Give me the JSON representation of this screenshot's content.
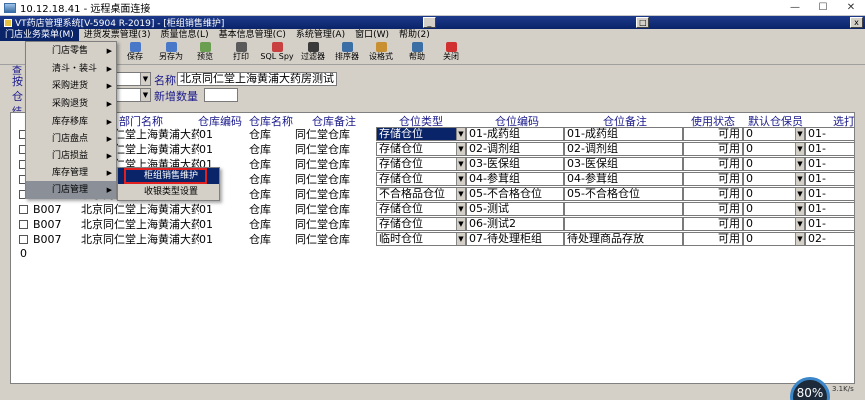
{
  "rdp": {
    "title": "10.12.18.41 - 远程桌面连接",
    "min": "—",
    "max": "☐",
    "close": "✕"
  },
  "app": {
    "title": "VT药店管理系统[V-5904 R-2019] - [柜组销售维护]",
    "btn_min": "_",
    "btn_max": "□",
    "btn_close": "x"
  },
  "menubar": [
    "门店业务菜单(M)",
    "进货发票管理(3)",
    "质量信息(L)",
    "基本信息管理(C)",
    "系统管理(A)",
    "窗口(W)",
    "帮助(2)"
  ],
  "toolbar": [
    {
      "label": "保存",
      "icon": "save-icon",
      "color": "#4a78c8"
    },
    {
      "label": "保存",
      "icon": "save-icon",
      "color": "#4a78c8"
    },
    {
      "label": "另存为",
      "icon": "save-as-icon",
      "color": "#4a78c8"
    },
    {
      "label": "预览",
      "icon": "preview-icon",
      "color": "#6a9e50"
    },
    {
      "label": "打印",
      "icon": "print-icon",
      "color": "#5a5a5a"
    },
    {
      "label": "SQL Spy",
      "icon": "sql-spy-icon",
      "color": "#c84040"
    },
    {
      "label": "过滤器",
      "icon": "filter-icon",
      "color": "#3a3a3a"
    },
    {
      "label": "排序器",
      "icon": "sort-icon",
      "color": "#3a6ea5"
    },
    {
      "label": "设格式",
      "icon": "format-icon",
      "color": "#c89030"
    },
    {
      "label": "帮助",
      "icon": "help-icon",
      "color": "#3a6ea5"
    },
    {
      "label": "关闭",
      "icon": "close-icon",
      "color": "#d03030"
    }
  ],
  "filters": {
    "left_labels": [
      "查",
      "按",
      "仓",
      "结"
    ],
    "name_label": "名称",
    "name_value": "北京同仁堂上海黄浦大药房测试",
    "add_qty_label": "新增数量",
    "add_qty_value": ""
  },
  "grid": {
    "headers": [
      "部门名称",
      "仓库编码",
      "仓库名称",
      "仓库备注",
      "仓位类型",
      "仓位编码",
      "仓位备注",
      "使用状态",
      "默认仓保员",
      "选打"
    ],
    "rows": [
      {
        "code": "",
        "dept": "北京同仁堂上海黄浦大药房",
        "wh_code": "01",
        "wh_name": "仓库",
        "wh_note": "同仁堂仓库",
        "type": "存储仓位",
        "loc_code": "01-成药组",
        "loc_note": "01-成药组",
        "status": "可用",
        "keeper": "0",
        "extra": "01-"
      },
      {
        "code": "",
        "dept": "北京同仁堂上海黄浦大药房",
        "wh_code": "01",
        "wh_name": "仓库",
        "wh_note": "同仁堂仓库",
        "type": "存储仓位",
        "loc_code": "02-调剂组",
        "loc_note": "02-调剂组",
        "status": "可用",
        "keeper": "0",
        "extra": "01-"
      },
      {
        "code": "",
        "dept": "北京同仁堂上海黄浦大药房",
        "wh_code": "01",
        "wh_name": "仓库",
        "wh_note": "同仁堂仓库",
        "type": "存储仓位",
        "loc_code": "03-医保组",
        "loc_note": "03-医保组",
        "status": "可用",
        "keeper": "0",
        "extra": "01-"
      },
      {
        "code": "",
        "dept": "北京同仁堂上海黄浦大药房",
        "wh_code": "01",
        "wh_name": "仓库",
        "wh_note": "同仁堂仓库",
        "type": "存储仓位",
        "loc_code": "04-参茸组",
        "loc_note": "04-参茸组",
        "status": "可用",
        "keeper": "0",
        "extra": "01-"
      },
      {
        "code": "B007",
        "dept": "北京同仁堂上海黄浦大药房",
        "wh_code": "01",
        "wh_name": "仓库",
        "wh_note": "同仁堂仓库",
        "type": "不合格品仓位",
        "loc_code": "05-不合格仓位",
        "loc_note": "05-不合格仓位",
        "status": "可用",
        "keeper": "0",
        "extra": "01-"
      },
      {
        "code": "B007",
        "dept": "北京同仁堂上海黄浦大药房",
        "wh_code": "01",
        "wh_name": "仓库",
        "wh_note": "同仁堂仓库",
        "type": "存储仓位",
        "loc_code": "05-测试",
        "loc_note": "",
        "status": "可用",
        "keeper": "0",
        "extra": "01-"
      },
      {
        "code": "B007",
        "dept": "北京同仁堂上海黄浦大药房",
        "wh_code": "01",
        "wh_name": "仓库",
        "wh_note": "同仁堂仓库",
        "type": "存储仓位",
        "loc_code": "06-测试2",
        "loc_note": "",
        "status": "可用",
        "keeper": "0",
        "extra": "01-"
      },
      {
        "code": "B007",
        "dept": "北京同仁堂上海黄浦大药房",
        "wh_code": "01",
        "wh_name": "仓库",
        "wh_note": "同仁堂仓库",
        "type": "临时仓位",
        "loc_code": "07-待处理柜组",
        "loc_note": "待处理商品存放",
        "status": "可用",
        "keeper": "0",
        "extra": "02-"
      }
    ],
    "footer_count": "0"
  },
  "menu1": [
    "门店零售",
    "清斗・装斗",
    "采购进货",
    "采购退货",
    "库存移库",
    "门店盘点",
    "门店损益",
    "库存管理",
    "门店管理"
  ],
  "menu2": [
    "柜组销售维护",
    "收银类型设置"
  ],
  "tray": {
    "gauge": "80%",
    "net": "3.1K/s"
  }
}
